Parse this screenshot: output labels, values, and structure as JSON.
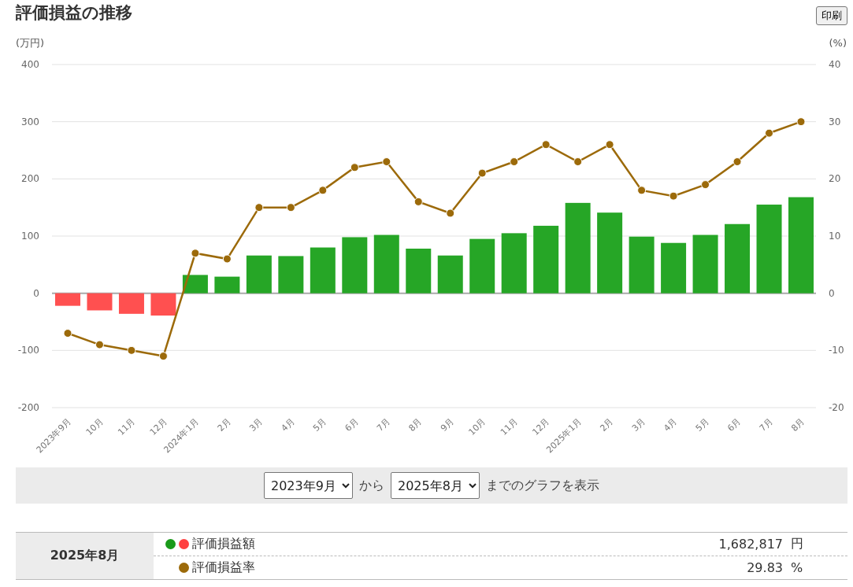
{
  "title": "評価損益の推移",
  "print_button": "印刷",
  "chart": {
    "chart_data": {
      "type": "bar",
      "ylabel": "(万円)",
      "grid": true,
      "categories": [
        "2023年9月",
        "10月",
        "11月",
        "12月",
        "2024年1月",
        "2月",
        "3月",
        "4月",
        "5月",
        "6月",
        "7月",
        "8月",
        "9月",
        "10月",
        "11月",
        "12月",
        "2025年1月",
        "2月",
        "3月",
        "4月",
        "5月",
        "6月",
        "7月",
        "8月"
      ],
      "ylim": [
        -200,
        400
      ],
      "yticks": [
        -200,
        -100,
        0,
        100,
        200,
        300,
        400
      ],
      "series": [
        {
          "color": "#26a626",
          "values": [
            null,
            null,
            null,
            null,
            32,
            29,
            66,
            65,
            80,
            98,
            102,
            78,
            66,
            95,
            105,
            118,
            158,
            141,
            99,
            88,
            102,
            121,
            155,
            168
          ]
        },
        {
          "color": "#ff5050",
          "values": [
            -22,
            -30,
            -36,
            -39,
            null,
            null,
            null,
            null,
            null,
            null,
            null,
            null,
            null,
            null,
            null,
            null,
            null,
            null,
            null,
            null,
            null,
            null,
            null,
            null
          ]
        }
      ]
    },
    "overlay": {
      "chart_data": {
        "type": "line",
        "ylabel": "(%)",
        "ylim": [
          -20,
          40
        ],
        "yticks": [
          -20,
          -10,
          0,
          10,
          20,
          30,
          40
        ],
        "series": [
          {
            "color": "#9c6a0a",
            "marker": "circle",
            "values": [
              -7,
              -9,
              -10,
              -11,
              7,
              6,
              15,
              15,
              18,
              22,
              23,
              16,
              14,
              21,
              23,
              26,
              23,
              26,
              18,
              17,
              19,
              23,
              28,
              30
            ]
          }
        ]
      }
    }
  },
  "range": {
    "from": "2023年9月",
    "between": "から",
    "to": "2025年8月",
    "suffix": "までのグラフを表示"
  },
  "summary": {
    "period": "2025年8月",
    "rows": [
      {
        "label": "評価損益額",
        "value": "1,682,817",
        "unit": "円",
        "dots": [
          {
            "color": "#1a9a1a"
          },
          {
            "color": "#ff4040"
          }
        ]
      },
      {
        "label": "評価損益率",
        "value": "29.83",
        "unit": "%",
        "dots": [
          {
            "color": "#9c6a0a"
          }
        ]
      }
    ]
  }
}
